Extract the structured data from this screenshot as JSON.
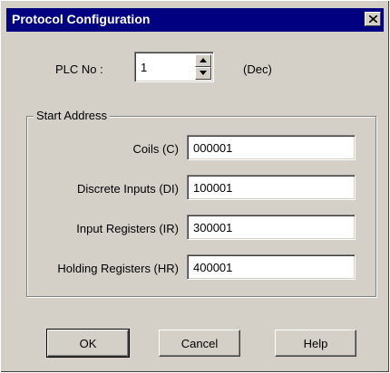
{
  "window": {
    "title": "Protocol Configuration"
  },
  "plc": {
    "label": "PLC No :",
    "value": "1",
    "unit": "(Dec)"
  },
  "start_address": {
    "group_label": "Start Address",
    "fields": [
      {
        "label": "Coils (C)",
        "value": "000001"
      },
      {
        "label": "Discrete Inputs (DI)",
        "value": "100001"
      },
      {
        "label": "Input Registers (IR)",
        "value": "300001"
      },
      {
        "label": "Holding Registers (HR)",
        "value": "400001"
      }
    ]
  },
  "buttons": {
    "ok": "OK",
    "cancel": "Cancel",
    "help": "Help"
  }
}
